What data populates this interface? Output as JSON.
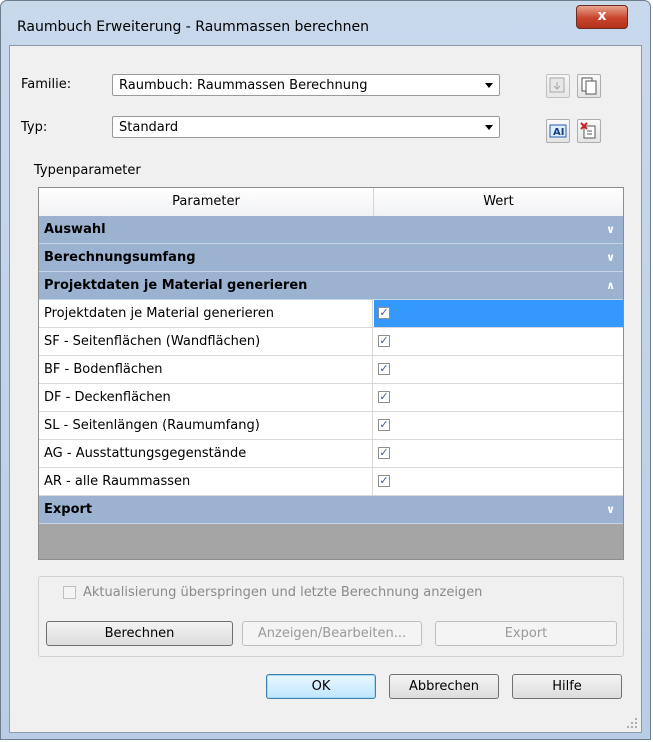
{
  "window": {
    "title": "Raumbuch Erweiterung - Raummassen berechnen",
    "close_glyph": "x"
  },
  "familie": {
    "label": "Familie:",
    "value": "Raumbuch: Raummassen Berechnung"
  },
  "typ": {
    "label": "Typ:",
    "value": "Standard"
  },
  "typenparameter_label": "Typenparameter",
  "grid": {
    "col_parameter": "Parameter",
    "col_wert": "Wert",
    "groups": {
      "auswahl": "Auswahl",
      "berechnungsumfang": "Berechnungsumfang",
      "projektdaten": "Projektdaten je Material generieren",
      "export": "Export"
    },
    "rows": [
      {
        "label": "Projektdaten je Material generieren",
        "checked": true
      },
      {
        "label": "SF - Seitenflächen (Wandflächen)",
        "checked": true
      },
      {
        "label": "BF - Bodenflächen",
        "checked": true
      },
      {
        "label": "DF - Deckenflächen",
        "checked": true
      },
      {
        "label": "SL - Seitenlängen (Raumumfang)",
        "checked": true
      },
      {
        "label": "AG - Ausstattungsgegenstände",
        "checked": true
      },
      {
        "label": "AR - alle Raummassen",
        "checked": true
      }
    ],
    "check_glyph": "✓"
  },
  "options": {
    "skip_label": "Aktualisierung überspringen und letzte Berechnung anzeigen",
    "berechnen": "Berechnen",
    "anzeigen": "Anzeigen/Bearbeiten...",
    "export": "Export"
  },
  "footer": {
    "ok": "OK",
    "abbrechen": "Abbrechen",
    "hilfe": "Hilfe"
  },
  "colors": {
    "group_bg": "#9bb3d1",
    "selection": "#3399ff",
    "title_bg": "#c9d9ec"
  }
}
